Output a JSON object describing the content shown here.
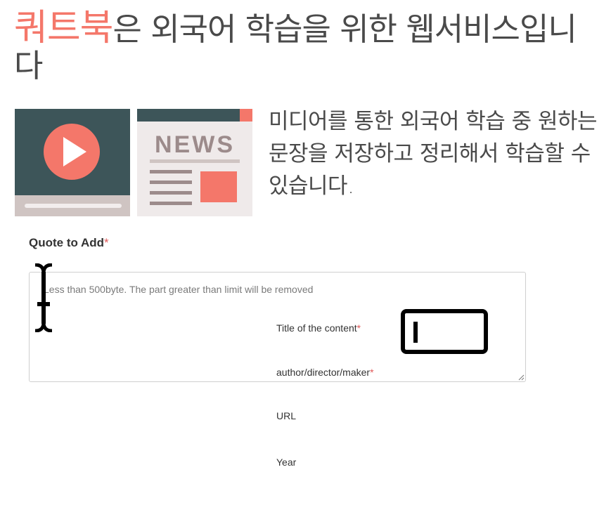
{
  "header": {
    "brand": "쿼트북",
    "headline_rest": "은 외국어 학습을 위한 웹서비스입니다",
    "description": "미디어를 통한 외국어 학습 중 원하는 문장을 저장하고 정리해서 학습할 수 있습니다."
  },
  "illustrations": {
    "video_icon": "video-player-icon",
    "news_icon": "newspaper-icon",
    "news_text": "NEWS",
    "colors": {
      "coral": "#f4776a",
      "slate": "#3d5559",
      "bg_grey": "#efeaea"
    }
  },
  "form": {
    "quote_label": "Quote to Add",
    "required_mark": "*",
    "quote_placeholder": "Less than 500byte. The part greater than limit will be removed",
    "title_label": "Title of the content",
    "author_label": "author/director/maker",
    "url_label": "URL",
    "year_label": "Year"
  }
}
